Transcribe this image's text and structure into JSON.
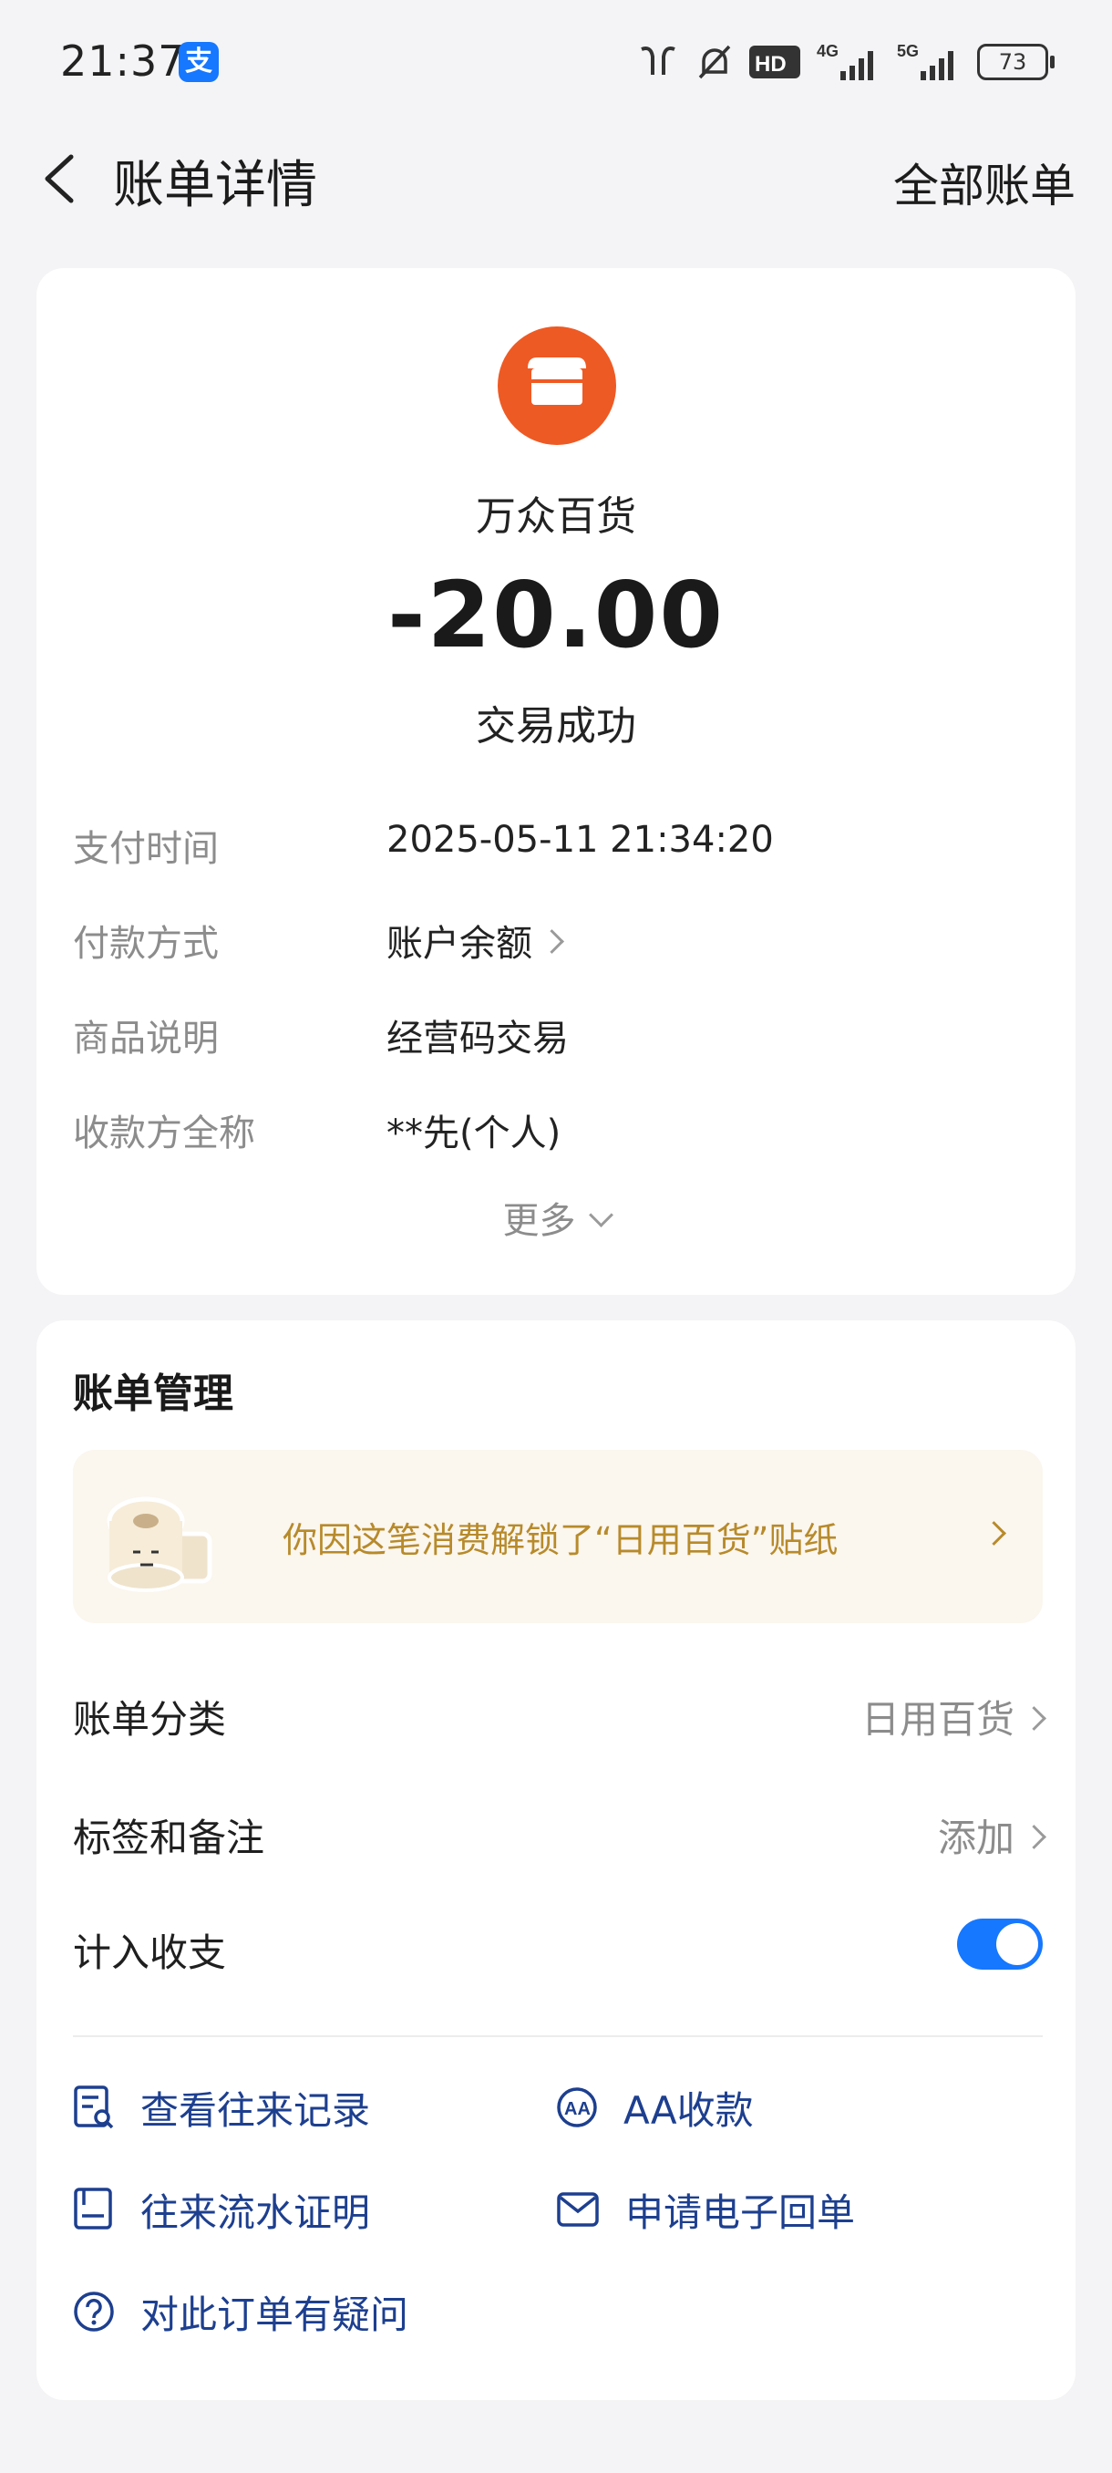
{
  "status_bar": {
    "time": "21:37",
    "app_icon": "alipay-icon",
    "hd_label": "HD",
    "net1": "4G",
    "net2": "5G",
    "battery": "73"
  },
  "nav": {
    "title": "账单详情",
    "right_action": "全部账单"
  },
  "summary": {
    "merchant_name": "万众百货",
    "amount": "-20.00",
    "status": "交易成功",
    "logo_color": "#ee5a24"
  },
  "details": [
    {
      "label": "支付时间",
      "value": "2025-05-11 21:34:20"
    },
    {
      "label": "付款方式",
      "value": "账户余额"
    },
    {
      "label": "商品说明",
      "value": "经营码交易"
    },
    {
      "label": "收款方全称",
      "value": "**先(个人)"
    }
  ],
  "more_label": "更多",
  "management": {
    "title": "账单管理",
    "sticker_text": "你因这笔消费解锁了“日用百货”贴纸",
    "category_label": "账单分类",
    "category_value": "日用百货",
    "tags_label": "标签和备注",
    "tags_value": "添加",
    "include_label": "计入收支",
    "include_on": true
  },
  "actions": {
    "history": "查看往来记录",
    "aa": "AA收款",
    "proof": "往来流水证明",
    "receipt": "申请电子回单",
    "question": "对此订单有疑问"
  },
  "colors": {
    "accent": "#1677ff",
    "link": "#1d3f8f",
    "sticker_text": "#b78a2b"
  }
}
